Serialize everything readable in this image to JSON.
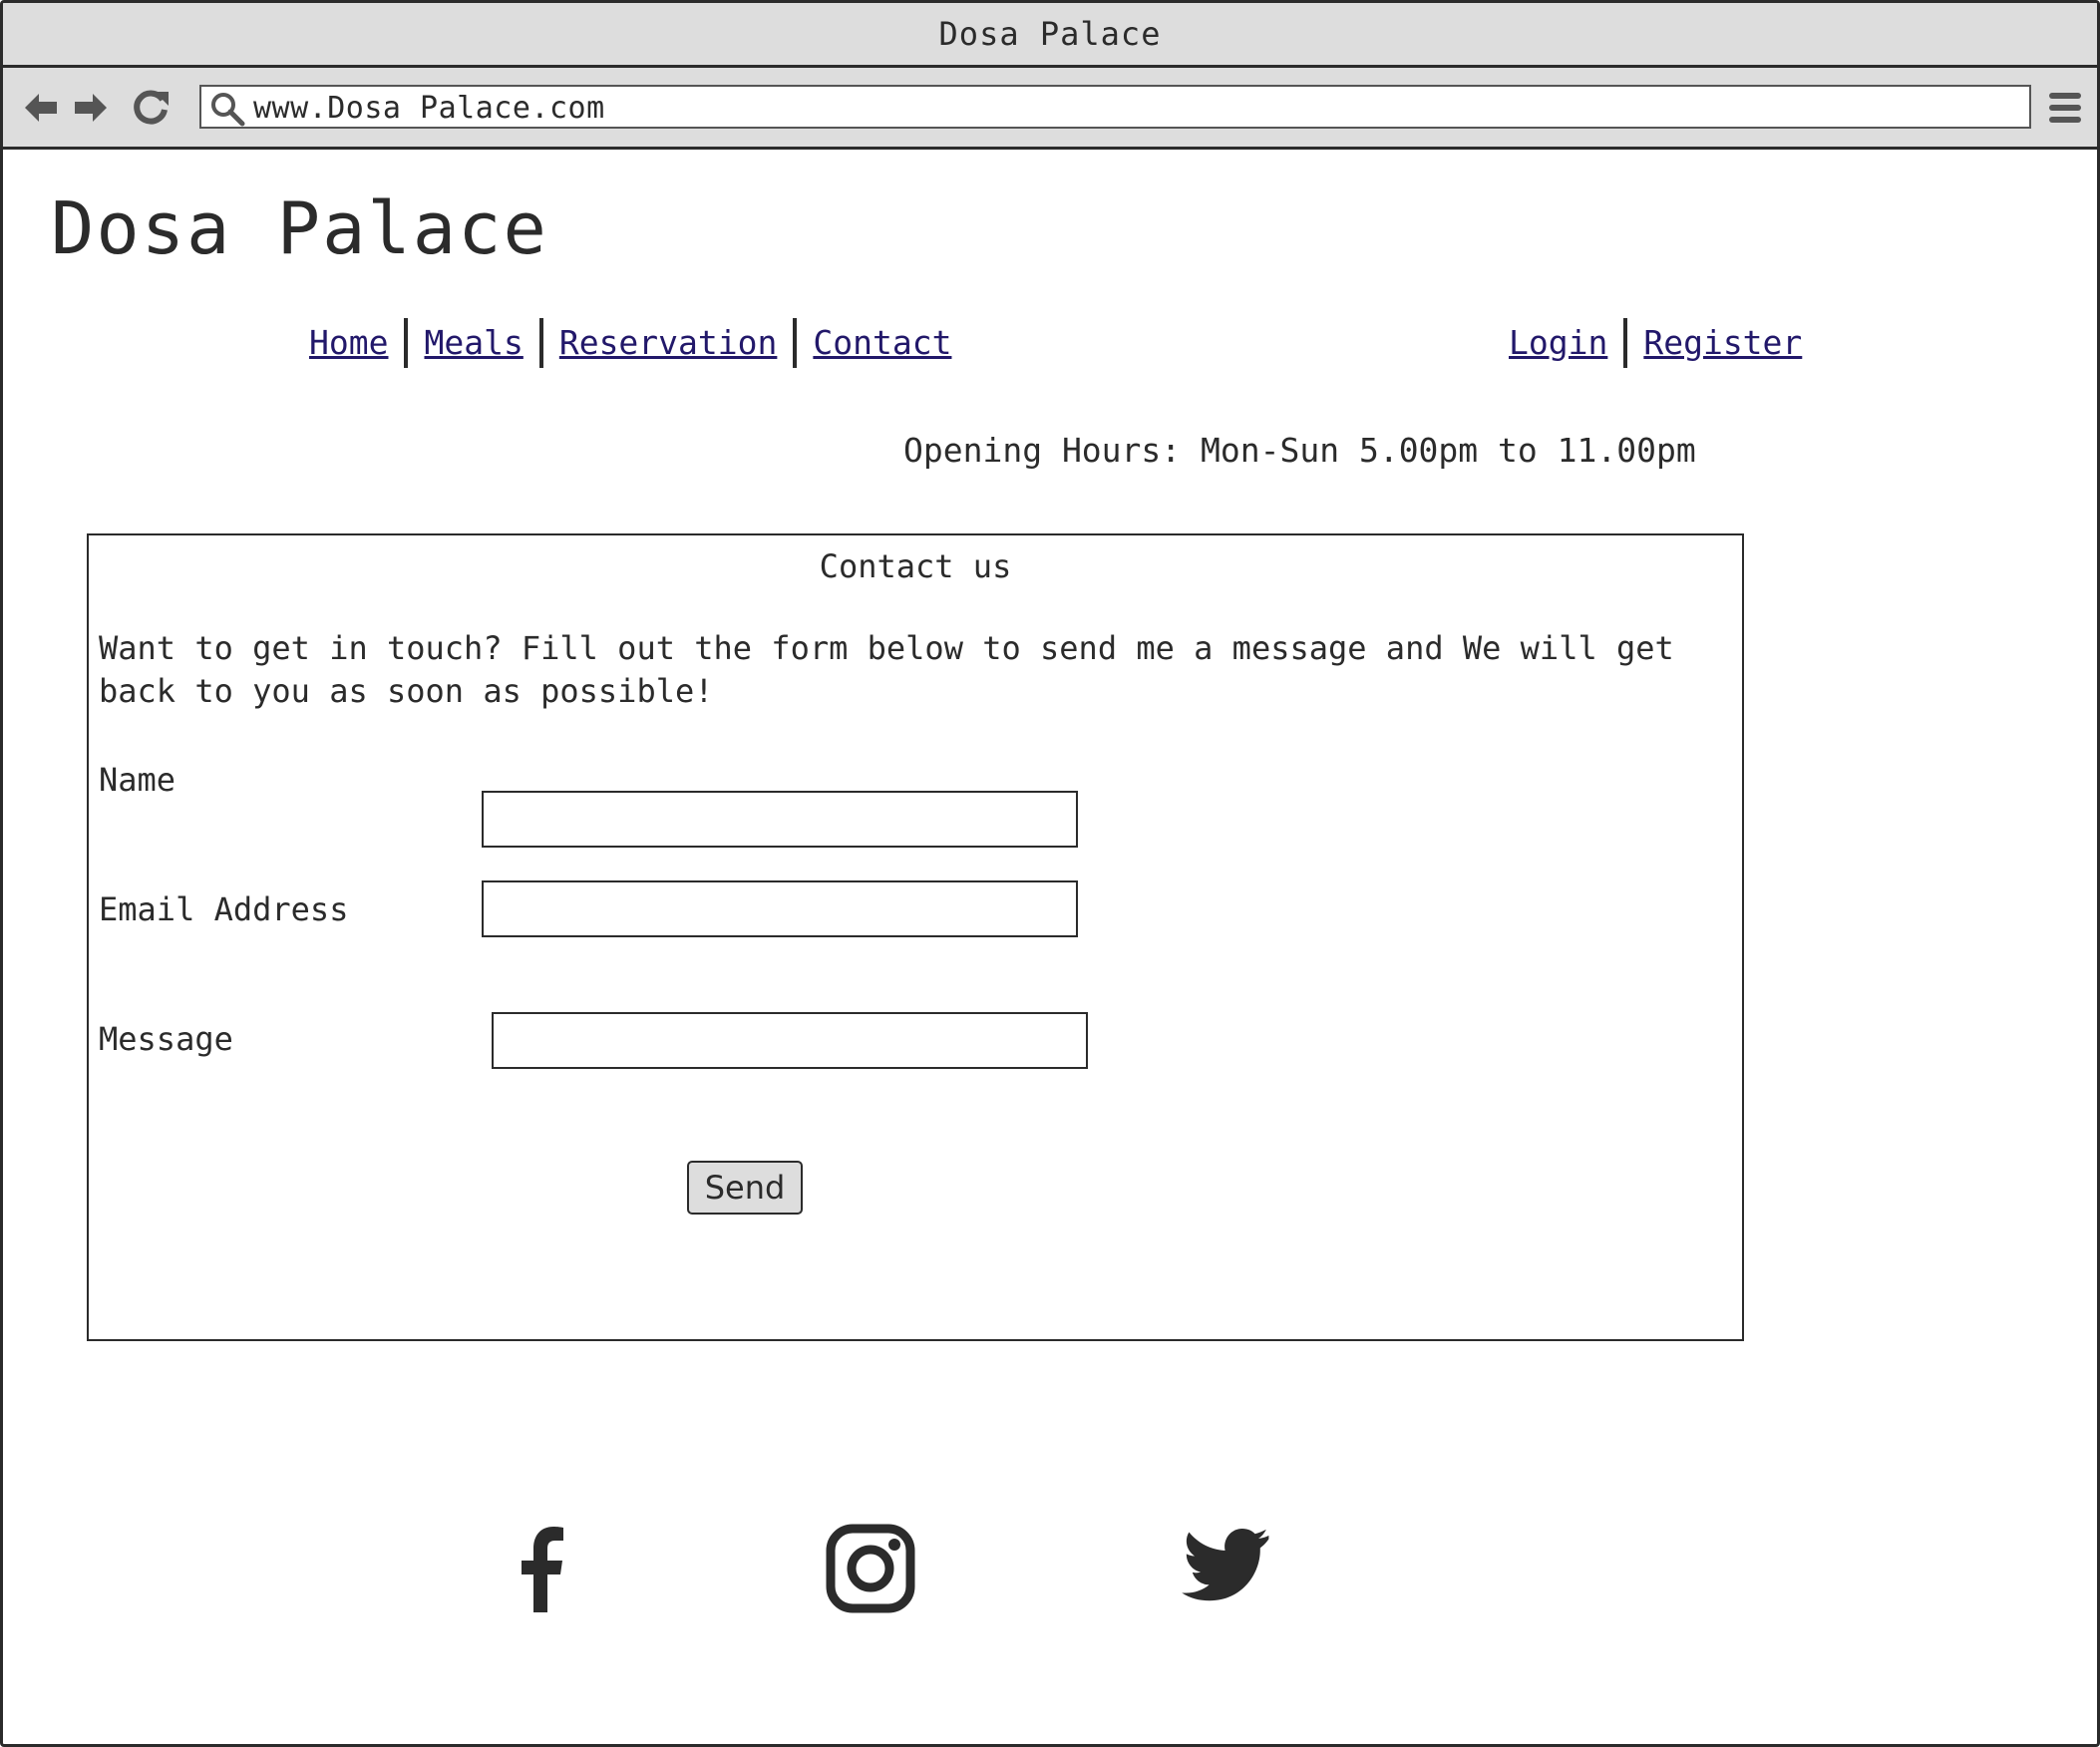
{
  "window": {
    "title": "Dosa Palace"
  },
  "browser": {
    "url": "www.Dosa Palace.com",
    "icons": [
      "back-arrow-icon",
      "forward-arrow-icon",
      "reload-icon",
      "search-icon",
      "hamburger-menu-icon"
    ]
  },
  "site": {
    "title": "Dosa Palace"
  },
  "nav": {
    "home": "Home",
    "meals": "Meals",
    "reservation": "Reservation",
    "contact": "Contact",
    "login": "Login",
    "register": "Register"
  },
  "hours": "Opening Hours: Mon-Sun 5.00pm to 11.00pm",
  "contact": {
    "title": "Contact us",
    "intro": "Want to get in touch? Fill out the form below to send me a message and We will get back to you as soon as possible!",
    "name_label": "Name",
    "name_value": "",
    "email_label": "Email Address",
    "email_value": "",
    "message_label": "Message",
    "message_value": "",
    "send_label": "Send"
  },
  "social": {
    "icons": [
      "facebook-icon",
      "instagram-icon",
      "twitter-icon"
    ]
  },
  "colors": {
    "chrome": "#dddddd",
    "ink": "#2b2b2b",
    "link": "#22186a"
  }
}
